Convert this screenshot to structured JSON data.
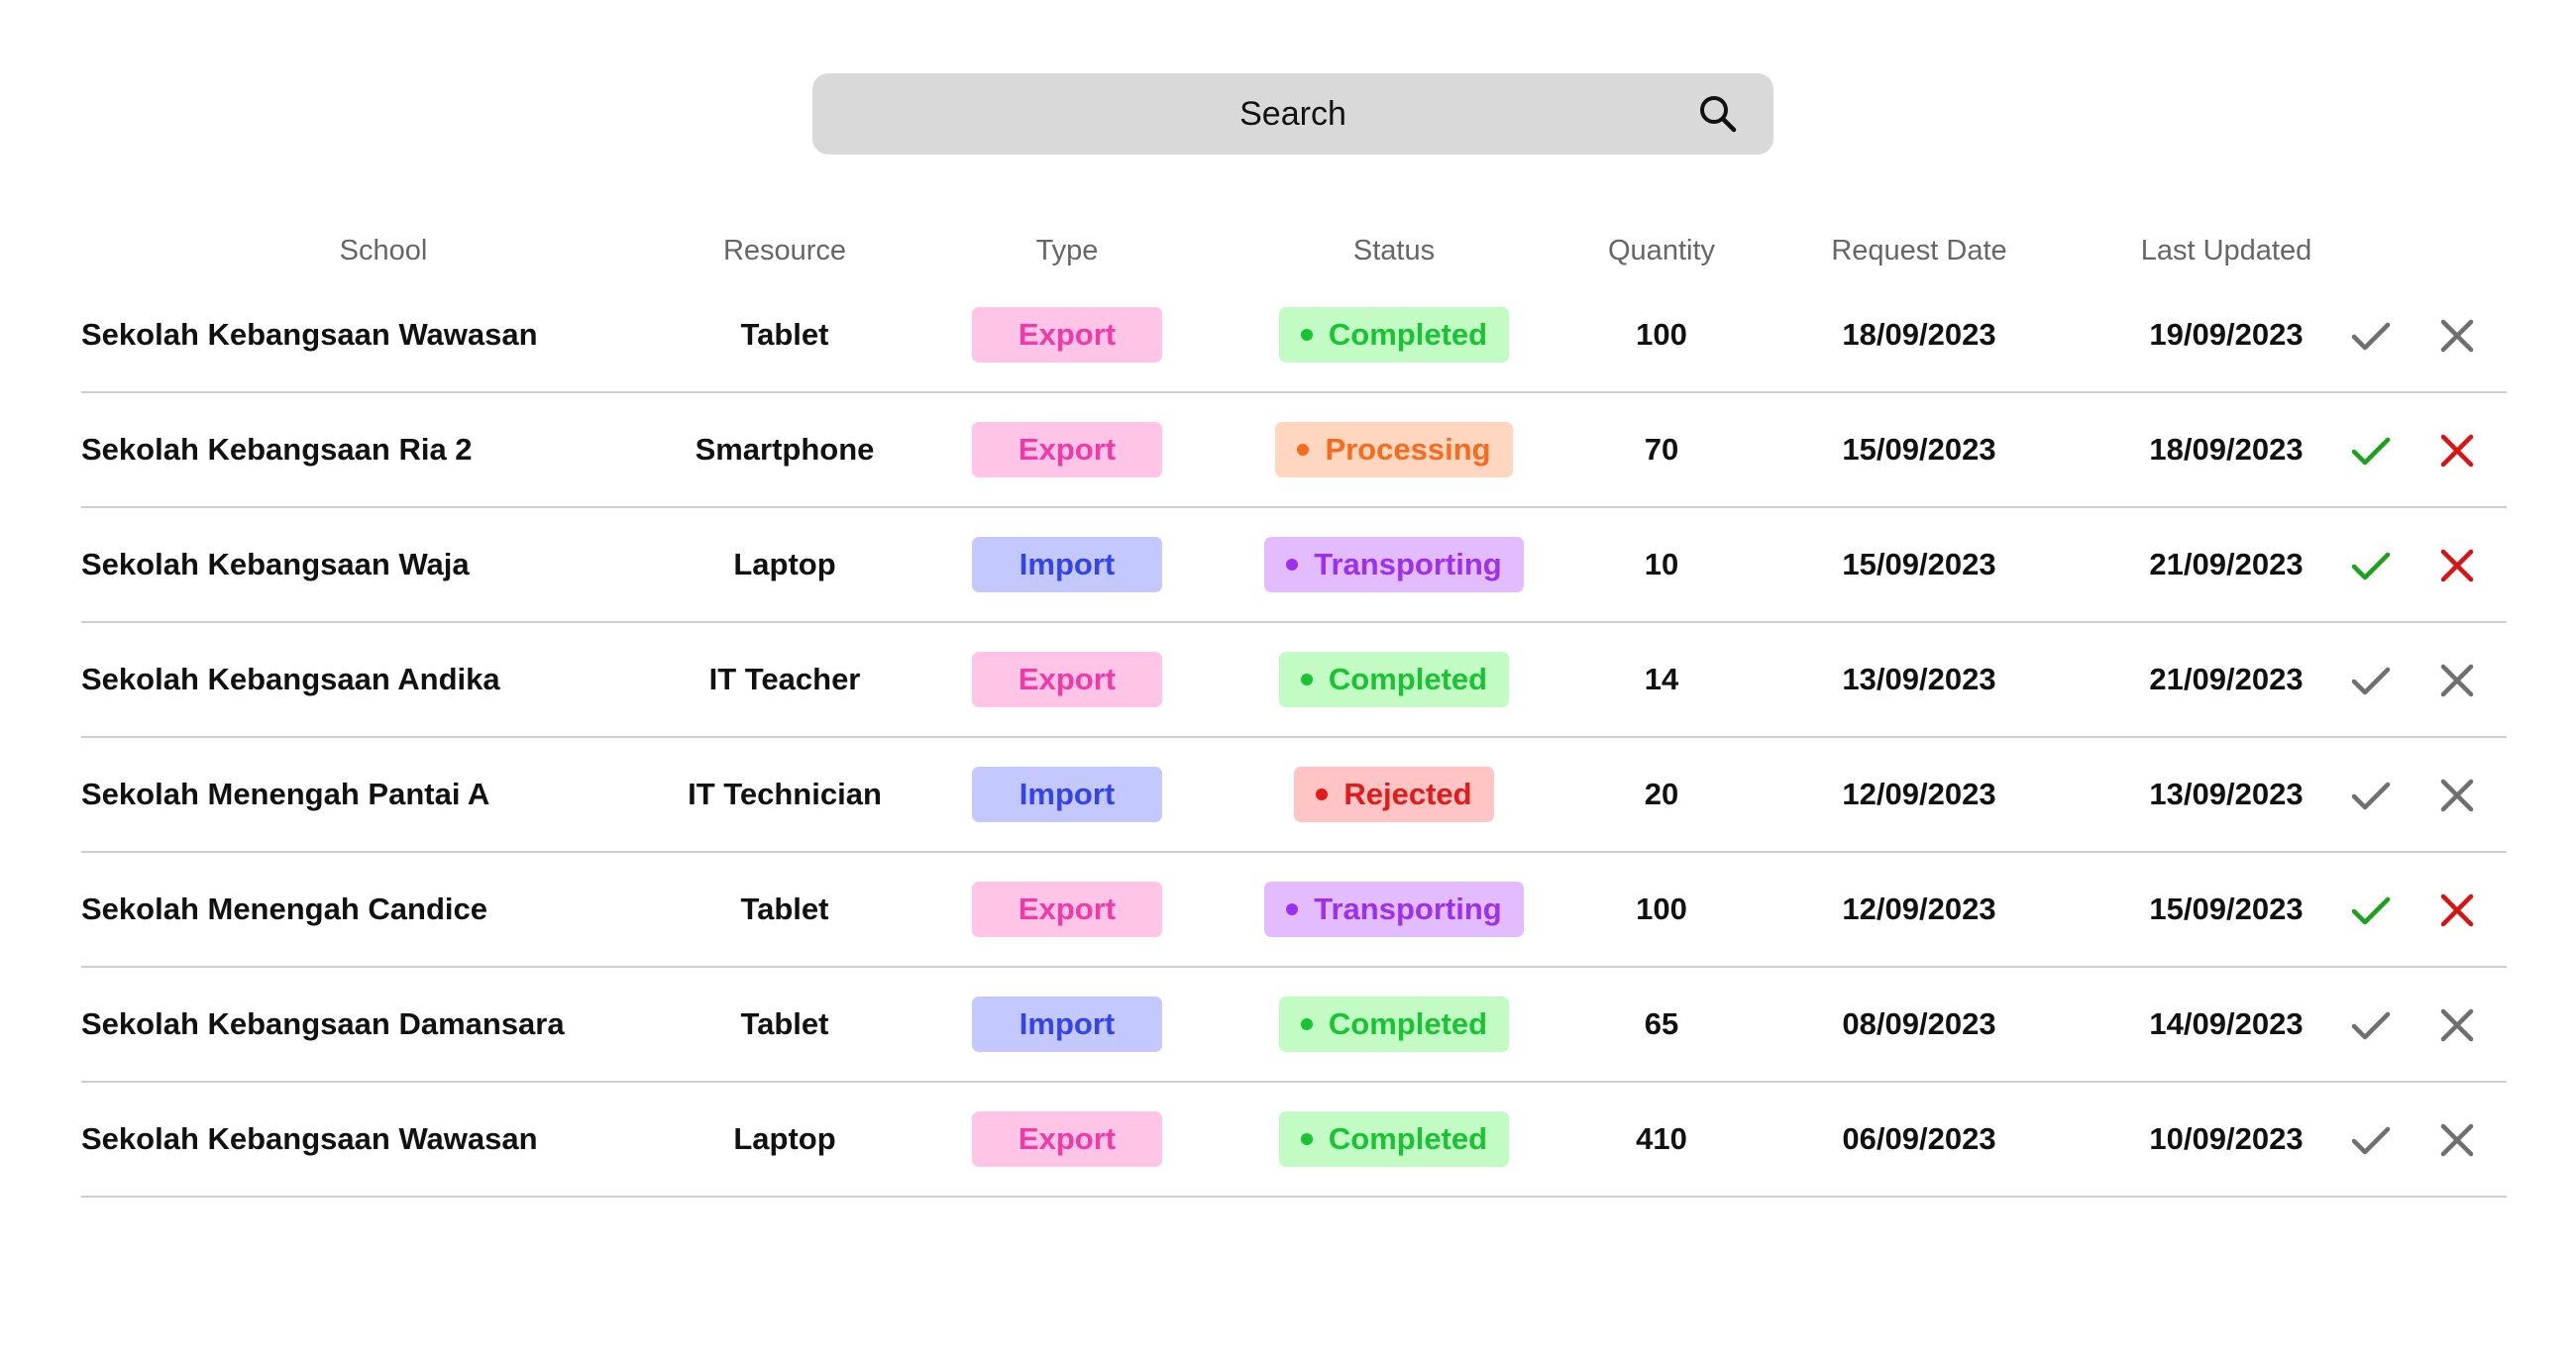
{
  "search": {
    "label": "Search"
  },
  "columns": [
    "School",
    "Resource",
    "Type",
    "Status",
    "Quantity",
    "Request Date",
    "Last Updated"
  ],
  "type_styles": {
    "Export": {
      "bg": "#ffc4e6",
      "fg": "#f03aa8"
    },
    "Import": {
      "bg": "#c3c8ff",
      "fg": "#3344ee"
    }
  },
  "status_styles": {
    "Completed": {
      "bg": "#c2fbc4",
      "fg": "#18c431"
    },
    "Processing": {
      "bg": "#ffd6bf",
      "fg": "#f86a1c"
    },
    "Transporting": {
      "bg": "#e3bcff",
      "fg": "#9b2ff2"
    },
    "Rejected": {
      "bg": "#ffc4c4",
      "fg": "#e21a1a"
    }
  },
  "action_colors": {
    "active_approve": "#1aa31a",
    "active_reject": "#dd1111",
    "inactive": "#6f6f6f"
  },
  "rows": [
    {
      "school": "Sekolah Kebangsaan Wawasan",
      "resource": "Tablet",
      "type": "Export",
      "status": "Completed",
      "quantity": "100",
      "request_date": "18/09/2023",
      "last_updated": "19/09/2023",
      "actions_active": false
    },
    {
      "school": "Sekolah Kebangsaan Ria 2",
      "resource": "Smartphone",
      "type": "Export",
      "status": "Processing",
      "quantity": "70",
      "request_date": "15/09/2023",
      "last_updated": "18/09/2023",
      "actions_active": true
    },
    {
      "school": "Sekolah Kebangsaan Waja",
      "resource": "Laptop",
      "type": "Import",
      "status": "Transporting",
      "quantity": "10",
      "request_date": "15/09/2023",
      "last_updated": "21/09/2023",
      "actions_active": true
    },
    {
      "school": "Sekolah Kebangsaan Andika",
      "resource": "IT Teacher",
      "type": "Export",
      "status": "Completed",
      "quantity": "14",
      "request_date": "13/09/2023",
      "last_updated": "21/09/2023",
      "actions_active": false
    },
    {
      "school": "Sekolah Menengah Pantai A",
      "resource": "IT Technician",
      "type": "Import",
      "status": "Rejected",
      "quantity": "20",
      "request_date": "12/09/2023",
      "last_updated": "13/09/2023",
      "actions_active": false
    },
    {
      "school": "Sekolah Menengah Candice",
      "resource": "Tablet",
      "type": "Export",
      "status": "Transporting",
      "quantity": "100",
      "request_date": "12/09/2023",
      "last_updated": "15/09/2023",
      "actions_active": true
    },
    {
      "school": "Sekolah Kebangsaan Damansara",
      "resource": "Tablet",
      "type": "Import",
      "status": "Completed",
      "quantity": "65",
      "request_date": "08/09/2023",
      "last_updated": "14/09/2023",
      "actions_active": false
    },
    {
      "school": "Sekolah Kebangsaan Wawasan",
      "resource": "Laptop",
      "type": "Export",
      "status": "Completed",
      "quantity": "410",
      "request_date": "06/09/2023",
      "last_updated": "10/09/2023",
      "actions_active": false
    }
  ]
}
